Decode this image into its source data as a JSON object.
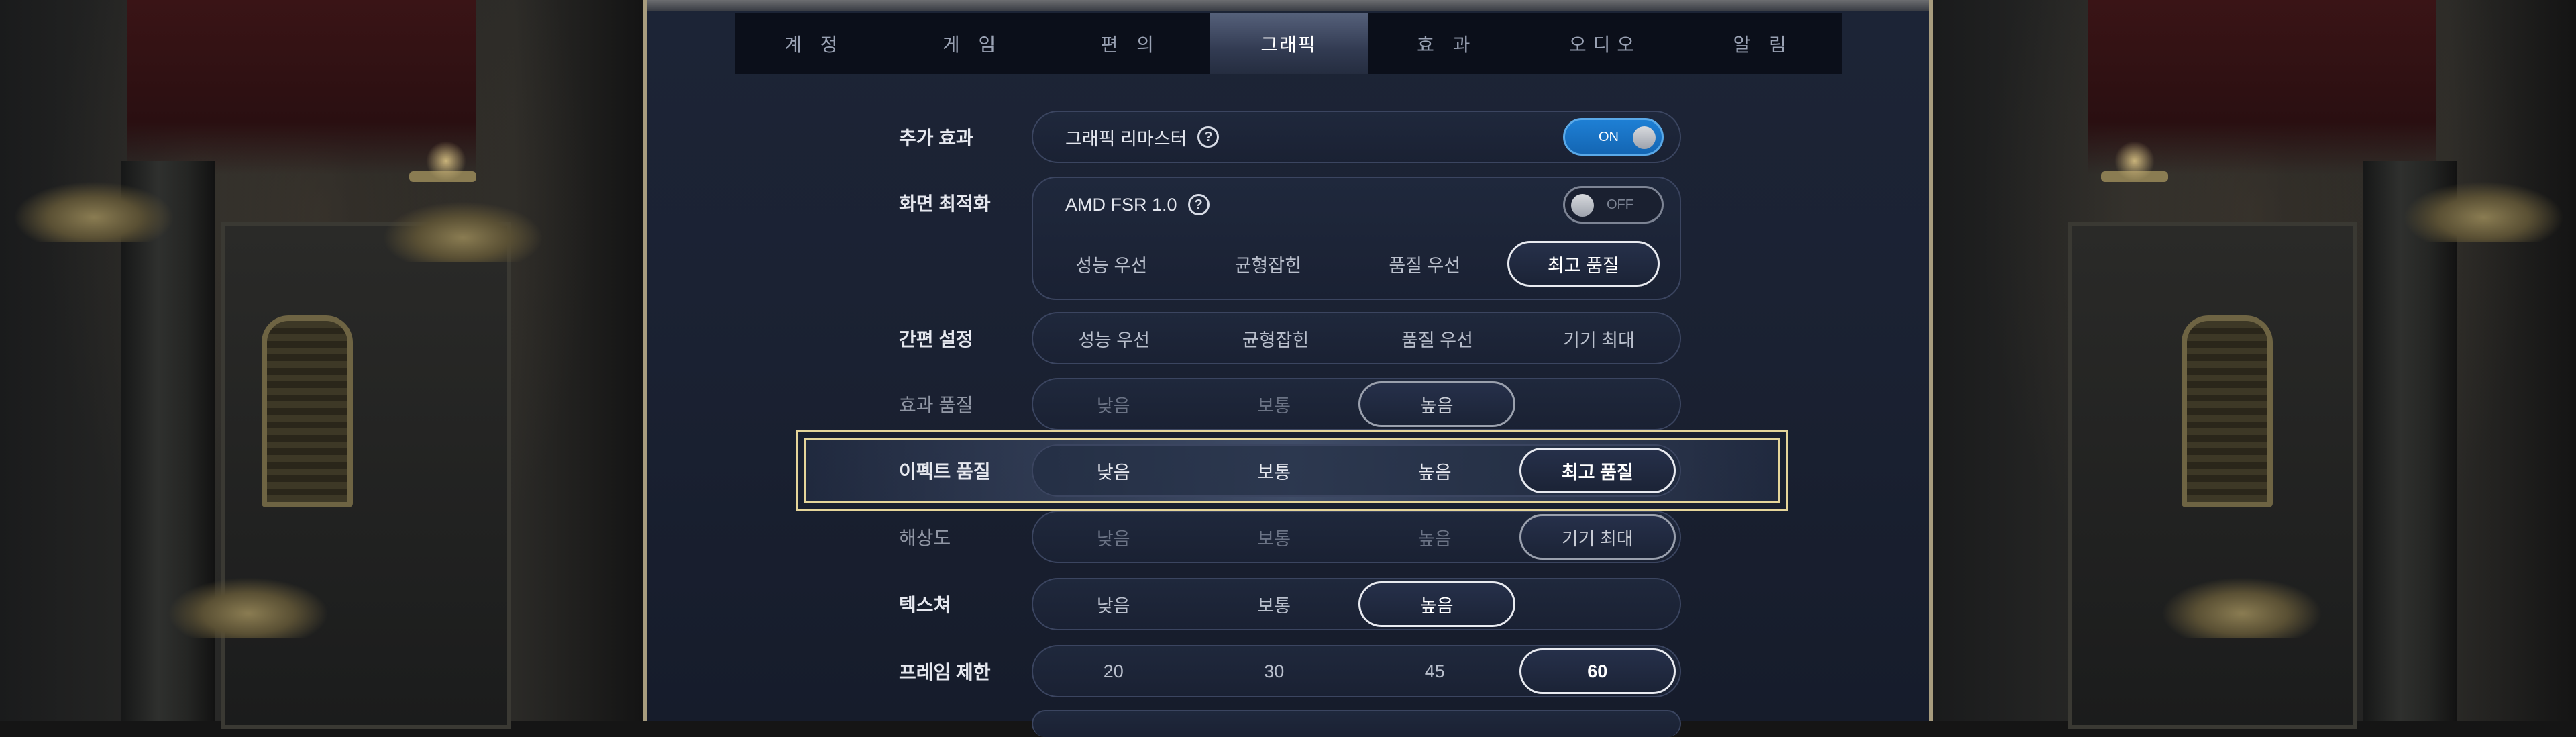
{
  "tabs": [
    "계 정",
    "게 임",
    "편 의",
    "그래픽",
    "효 과",
    "오디오",
    "알 림"
  ],
  "active_tab_index": 3,
  "extra_effects": {
    "label": "추가 효과",
    "option_label": "그래픽 리마스터",
    "help_icon": "?",
    "toggle_state": "ON"
  },
  "screen_optimization": {
    "label": "화면 최적화",
    "option_label": "AMD FSR 1.0",
    "help_icon": "?",
    "toggle_state": "OFF",
    "modes": [
      "성능 우선",
      "균형잡힌",
      "품질 우선",
      "최고 품질"
    ],
    "selected_mode": "최고 품질"
  },
  "quick_settings": {
    "label": "간편 설정",
    "options": [
      "성능 우선",
      "균형잡힌",
      "품질 우선",
      "기기 최대"
    ]
  },
  "effect_quality": {
    "label": "효과 품질",
    "options": [
      "낮음",
      "보통",
      "높음"
    ],
    "selected": "높음"
  },
  "fx_quality": {
    "label": "이펙트 품질",
    "options": [
      "낮음",
      "보통",
      "높음",
      "최고 품질"
    ],
    "selected": "최고 품질"
  },
  "resolution": {
    "label": "해상도",
    "options": [
      "낮음",
      "보통",
      "높음",
      "기기 최대"
    ],
    "selected": "기기 최대"
  },
  "texture": {
    "label": "텍스쳐",
    "options": [
      "낮음",
      "보통",
      "높음"
    ],
    "selected": "높음"
  },
  "frame_limit": {
    "label": "프레임 제한",
    "options": [
      "20",
      "30",
      "45",
      "60"
    ],
    "selected": "60"
  },
  "colors": {
    "accent_blue": "#1466b3",
    "highlight_gold": "#e5d59a",
    "panel_bg": "#1b2233"
  }
}
